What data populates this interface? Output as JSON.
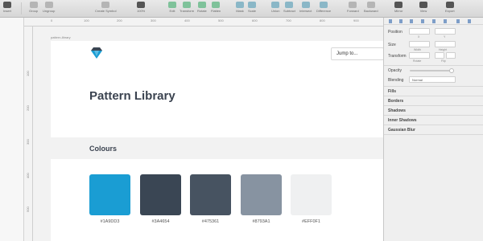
{
  "toolbar": {
    "items": [
      {
        "label": "Insert",
        "icon": "plus-icon"
      },
      {
        "label": "Group",
        "icon": "group-icon"
      },
      {
        "label": "Ungroup",
        "icon": "ungroup-icon"
      },
      {
        "label": "Create Symbol",
        "icon": "symbol-icon"
      },
      {
        "label": "100%",
        "icon": "zoom-icon"
      },
      {
        "label": "Edit",
        "icon": "edit-icon"
      },
      {
        "label": "Transform",
        "icon": "transform-icon"
      },
      {
        "label": "Rotate",
        "icon": "rotate-icon"
      },
      {
        "label": "Flatten",
        "icon": "flatten-icon"
      },
      {
        "label": "Mask",
        "icon": "mask-icon"
      },
      {
        "label": "Scale",
        "icon": "scale-icon"
      },
      {
        "label": "Union",
        "icon": "union-icon"
      },
      {
        "label": "Subtract",
        "icon": "subtract-icon"
      },
      {
        "label": "Intersect",
        "icon": "intersect-icon"
      },
      {
        "label": "Difference",
        "icon": "difference-icon"
      },
      {
        "label": "Forward",
        "icon": "forward-icon"
      },
      {
        "label": "Backward",
        "icon": "backward-icon"
      },
      {
        "label": "Mirror",
        "icon": "mirror-icon"
      },
      {
        "label": "View",
        "icon": "view-icon"
      },
      {
        "label": "Export",
        "icon": "export-icon"
      }
    ]
  },
  "ruler": {
    "labels": [
      "0",
      "100",
      "200",
      "300",
      "400",
      "500",
      "600",
      "700",
      "800",
      "900"
    ],
    "vlabels": [
      "100",
      "200",
      "300",
      "400",
      "500"
    ]
  },
  "artboard": {
    "name": "pattern-library",
    "title": "Pattern Library",
    "jump_label": "Jump to...",
    "section_title": "Colours",
    "swatches": [
      {
        "hex": "#1A9DD3",
        "label": "#1A9DD3"
      },
      {
        "hex": "#3A4654",
        "label": "#3A4654"
      },
      {
        "hex": "#475361",
        "label": "#475361"
      },
      {
        "hex": "#8793A1",
        "label": "#8793A1"
      },
      {
        "hex": "#EFF0F1",
        "label": "#EFF0F1"
      }
    ]
  },
  "inspector": {
    "position_label": "Position",
    "x_label": "X",
    "y_label": "Y",
    "size_label": "Size",
    "width_label": "Width",
    "height_label": "Height",
    "transform_label": "Transform",
    "rotate_label": "Rotate",
    "flip_label": "Flip",
    "opacity_label": "Opacity",
    "blending_label": "Blending",
    "blending_value": "Normal",
    "sections": [
      "Fills",
      "Borders",
      "Shadows",
      "Inner Shadows",
      "Gaussian Blur"
    ]
  }
}
